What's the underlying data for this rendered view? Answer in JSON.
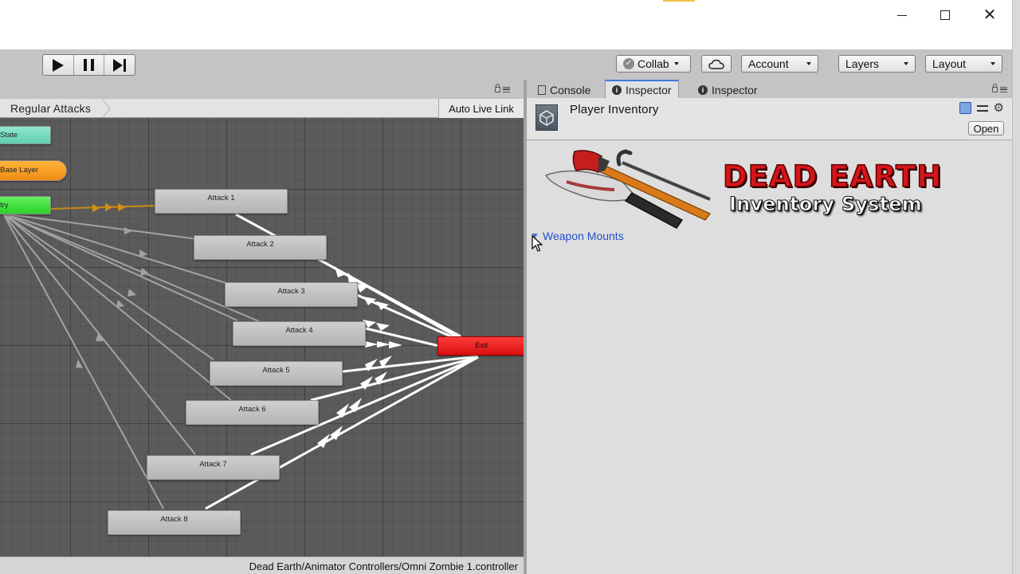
{
  "window": {
    "minimize_label": "—",
    "close_glyph": "✕"
  },
  "toolbar": {
    "collab_label": "Collab",
    "account_label": "Account",
    "layers_label": "Layers",
    "layout_label": "Layout"
  },
  "animator": {
    "breadcrumb": "Regular Attacks",
    "auto_live_link": "Auto Live Link",
    "nodes": {
      "any_state": "State",
      "base_layer": "Base Layer",
      "entry": "try",
      "exit": "Exit",
      "attacks": [
        "Attack 1",
        "Attack 2",
        "Attack 3",
        "Attack 4",
        "Attack 5",
        "Attack 6",
        "Attack 7",
        "Attack 8"
      ]
    },
    "footer_path": "Dead Earth/Animator Controllers/Omni Zombie 1.controller"
  },
  "tabs": [
    {
      "label": "Console",
      "icon": "console-icon"
    },
    {
      "label": "Inspector",
      "icon": "info-icon",
      "active": true
    },
    {
      "label": "Inspector",
      "icon": "info-icon"
    }
  ],
  "inspector": {
    "title": "Player Inventory",
    "open_label": "Open",
    "logo_title": "DEAD EARTH",
    "logo_subtitle": "Inventory System",
    "foldout_label": "Weapon Mounts"
  },
  "colors": {
    "accent": "#3a7be0",
    "exit_node": "#e01818",
    "entry_node": "#33d92f",
    "any_state_node": "#6fd9bd",
    "base_layer_node": "#f5a025",
    "link": "#2453c8"
  }
}
